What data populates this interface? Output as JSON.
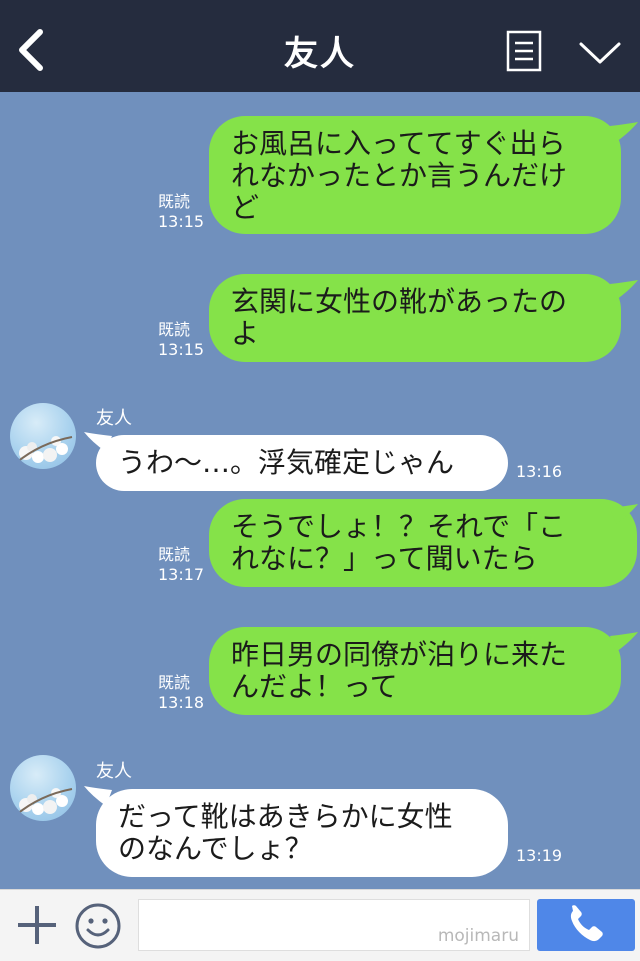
{
  "header": {
    "title": "友人",
    "back_icon": "chevron-left-icon",
    "menu_icon": "list-icon",
    "collapse_icon": "chevron-down-icon"
  },
  "messages": [
    {
      "direction": "sent",
      "text": "お風呂に入っててすぐ出ら\nれなかったとか言うんだけ\nど",
      "read": "既読",
      "time": "13:15"
    },
    {
      "direction": "sent",
      "text": "玄関に女性の靴があったの\nよ",
      "read": "既読",
      "time": "13:15"
    },
    {
      "direction": "received",
      "sender": "友人",
      "text": "うわ〜…。浮気確定じゃん",
      "time": "13:16"
    },
    {
      "direction": "sent",
      "text": "そうでしょ！？それで「こ\nれなに？」って聞いたら",
      "read": "既読",
      "time": "13:17"
    },
    {
      "direction": "sent",
      "text": "昨日男の同僚が泊りに来た\nんだよ！って",
      "read": "既読",
      "time": "13:18"
    },
    {
      "direction": "received",
      "sender": "友人",
      "text": "だって靴はあきらかに女性\nのなんでしょ？",
      "time": "13:19"
    }
  ],
  "footer": {
    "input_value": "",
    "watermark": "mojimaru",
    "plus_icon": "plus-icon",
    "emoji_icon": "smiley-icon",
    "call_icon": "phone-icon"
  },
  "colors": {
    "header_bg": "#252c3e",
    "chat_bg": "#7090bd",
    "sent_bubble": "#85e249",
    "received_bubble": "#ffffff",
    "call_button": "#4f87e8"
  }
}
